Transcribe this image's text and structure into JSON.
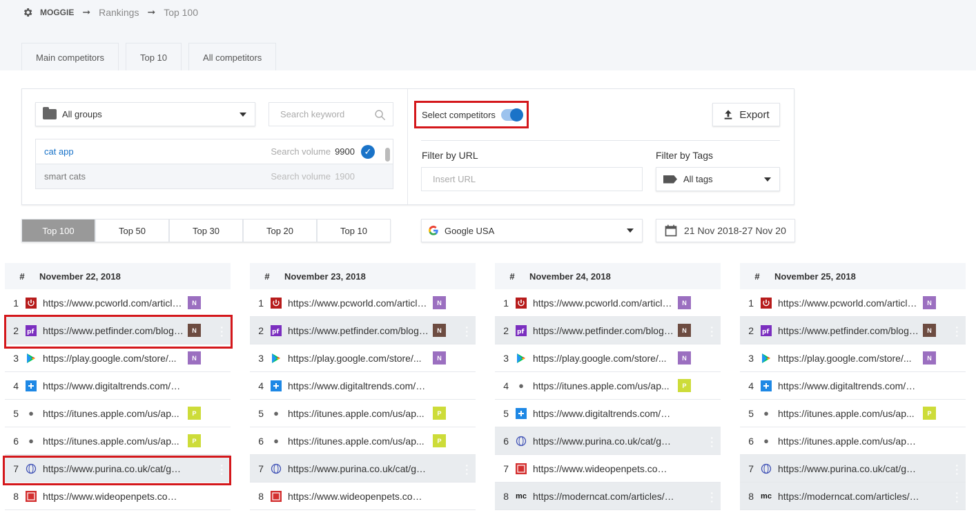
{
  "breadcrumb": {
    "project": "MOGGIE",
    "sep": "➞",
    "level1": "Rankings",
    "level2": "Top 100"
  },
  "tabs": [
    "Main competitors",
    "Top 10",
    "All competitors"
  ],
  "filters": {
    "groups_select": "All groups",
    "search_placeholder": "Search keyword",
    "keywords": [
      {
        "label": "cat app",
        "sv_label": "Search volume",
        "volume": "9900",
        "selected": true
      },
      {
        "label": "smart cats",
        "sv_label": "Search volume",
        "volume": "1900",
        "selected": false
      }
    ],
    "select_competitors_label": "Select competitors",
    "select_competitors_on": true,
    "export_label": "Export",
    "filter_url_label": "Filter by URL",
    "url_placeholder": "Insert URL",
    "filter_tags_label": "Filter by Tags",
    "tags_select": "All tags"
  },
  "top_selector": [
    "Top 100",
    "Top 50",
    "Top 30",
    "Top 20",
    "Top 10"
  ],
  "top_selector_active": "Top 100",
  "engine_select": "Google USA",
  "date_range": "21 Nov 2018-27 Nov 20",
  "colors": {
    "accent": "#1a73c8",
    "highlight_border": "#d4171b",
    "badge_N_purple": "#9b6fc0",
    "badge_N_brown": "#6d4c41",
    "badge_P": "#cddc39"
  },
  "columns": [
    {
      "date": "November 22, 2018",
      "hash": "#",
      "rows": [
        {
          "n": "1",
          "icon": "power",
          "url": "https://www.pcworld.com/article/...",
          "badge": "N",
          "badge_color": "purple",
          "hl": false
        },
        {
          "n": "2",
          "icon": "pf",
          "url": "https://www.petfinder.com/blog/...",
          "badge": "N",
          "badge_color": "brown",
          "hl": true
        },
        {
          "n": "3",
          "icon": "play",
          "url": "https://play.google.com/store/...",
          "badge": "N",
          "badge_color": "purple",
          "hl": false
        },
        {
          "n": "4",
          "icon": "dt",
          "url": "https://www.digitaltrends.com/m...",
          "badge": "",
          "badge_color": "",
          "hl": false
        },
        {
          "n": "5",
          "icon": "apple",
          "url": "https://itunes.apple.com/us/ap...",
          "badge": "P",
          "badge_color": "yellow",
          "hl": false
        },
        {
          "n": "6",
          "icon": "apple",
          "url": "https://itunes.apple.com/us/ap...",
          "badge": "P",
          "badge_color": "yellow",
          "hl": false
        },
        {
          "n": "7",
          "icon": "globe",
          "url": "https://www.purina.co.uk/cat/go-...",
          "badge": "",
          "badge_color": "",
          "hl": true
        },
        {
          "n": "8",
          "icon": "wop",
          "url": "https://www.wideopenpets.com/t...",
          "badge": "",
          "badge_color": "",
          "hl": false
        }
      ]
    },
    {
      "date": "November 23, 2018",
      "hash": "#",
      "rows": [
        {
          "n": "1",
          "icon": "power",
          "url": "https://www.pcworld.com/article/...",
          "badge": "N",
          "badge_color": "purple",
          "hl": false
        },
        {
          "n": "2",
          "icon": "pf",
          "url": "https://www.petfinder.com/blog/...",
          "badge": "N",
          "badge_color": "brown",
          "hl": true
        },
        {
          "n": "3",
          "icon": "play",
          "url": "https://play.google.com/store/...",
          "badge": "N",
          "badge_color": "purple",
          "hl": false
        },
        {
          "n": "4",
          "icon": "dt",
          "url": "https://www.digitaltrends.com/m...",
          "badge": "",
          "badge_color": "",
          "hl": false
        },
        {
          "n": "5",
          "icon": "apple",
          "url": "https://itunes.apple.com/us/ap...",
          "badge": "P",
          "badge_color": "yellow",
          "hl": false
        },
        {
          "n": "6",
          "icon": "apple",
          "url": "https://itunes.apple.com/us/ap...",
          "badge": "P",
          "badge_color": "yellow",
          "hl": false
        },
        {
          "n": "7",
          "icon": "globe",
          "url": "https://www.purina.co.uk/cat/go-...",
          "badge": "",
          "badge_color": "",
          "hl": true
        },
        {
          "n": "8",
          "icon": "wop",
          "url": "https://www.wideopenpets.com/t...",
          "badge": "",
          "badge_color": "",
          "hl": false
        }
      ]
    },
    {
      "date": "November 24, 2018",
      "hash": "#",
      "rows": [
        {
          "n": "1",
          "icon": "power",
          "url": "https://www.pcworld.com/article/...",
          "badge": "N",
          "badge_color": "purple",
          "hl": false
        },
        {
          "n": "2",
          "icon": "pf",
          "url": "https://www.petfinder.com/blog/...",
          "badge": "N",
          "badge_color": "brown",
          "hl": true
        },
        {
          "n": "3",
          "icon": "play",
          "url": "https://play.google.com/store/...",
          "badge": "N",
          "badge_color": "purple",
          "hl": false
        },
        {
          "n": "4",
          "icon": "apple",
          "url": "https://itunes.apple.com/us/ap...",
          "badge": "P",
          "badge_color": "yellow",
          "hl": false
        },
        {
          "n": "5",
          "icon": "dt",
          "url": "https://www.digitaltrends.com/m...",
          "badge": "",
          "badge_color": "",
          "hl": false
        },
        {
          "n": "6",
          "icon": "globe",
          "url": "https://www.purina.co.uk/cat/go-...",
          "badge": "",
          "badge_color": "",
          "hl": true
        },
        {
          "n": "7",
          "icon": "wop",
          "url": "https://www.wideopenpets.com/t...",
          "badge": "",
          "badge_color": "",
          "hl": false
        },
        {
          "n": "8",
          "icon": "mc",
          "url": "https://moderncat.com/articles/a...",
          "badge": "",
          "badge_color": "",
          "hl": true
        }
      ]
    },
    {
      "date": "November 25, 2018",
      "hash": "#",
      "rows": [
        {
          "n": "1",
          "icon": "power",
          "url": "https://www.pcworld.com/article/...",
          "badge": "N",
          "badge_color": "purple",
          "hl": false
        },
        {
          "n": "2",
          "icon": "pf",
          "url": "https://www.petfinder.com/blog/...",
          "badge": "N",
          "badge_color": "brown",
          "hl": true
        },
        {
          "n": "3",
          "icon": "play",
          "url": "https://play.google.com/store/...",
          "badge": "N",
          "badge_color": "purple",
          "hl": false
        },
        {
          "n": "4",
          "icon": "dt",
          "url": "https://www.digitaltrends.com/m...",
          "badge": "",
          "badge_color": "",
          "hl": false
        },
        {
          "n": "5",
          "icon": "apple",
          "url": "https://itunes.apple.com/us/ap...",
          "badge": "P",
          "badge_color": "yellow",
          "hl": false
        },
        {
          "n": "6",
          "icon": "apple",
          "url": "https://itunes.apple.com/us/app/...",
          "badge": "",
          "badge_color": "",
          "hl": false
        },
        {
          "n": "7",
          "icon": "globe",
          "url": "https://www.purina.co.uk/cat/go-...",
          "badge": "",
          "badge_color": "",
          "hl": true
        },
        {
          "n": "8",
          "icon": "mc",
          "url": "https://moderncat.com/articles/a...",
          "badge": "",
          "badge_color": "",
          "hl": true
        }
      ]
    }
  ]
}
